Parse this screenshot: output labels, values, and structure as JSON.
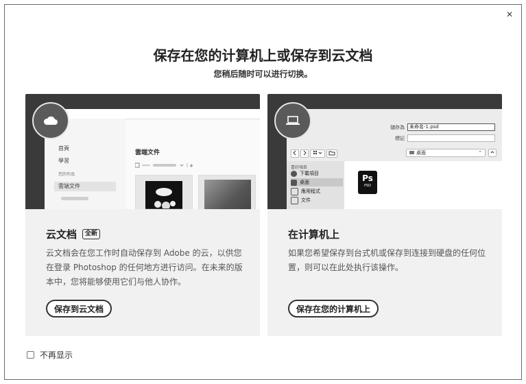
{
  "dialog": {
    "close_symbol": "×",
    "title": "保存在您的计算机上或保存到云文档",
    "subtitle": "您稍后随时可以进行切换。"
  },
  "cloud_card": {
    "badge_icon": "cloud-icon",
    "preview": {
      "nav_items": [
        "首頁",
        "學習",
        "您的作品",
        "雲端文件"
      ],
      "active_nav": "雲端文件",
      "main_title": "雲端文件"
    },
    "heading": "云文档",
    "tag": "全新",
    "description": "云文档会在您工作时自动保存到 Adobe 的云，以供您在登录 Photoshop 的任何地方进行访问。在未来的版本中，您将能够使用它们与他人协作。",
    "button_label": "保存到云文档"
  },
  "computer_card": {
    "badge_icon": "laptop-icon",
    "preview": {
      "save_as_label": "儲存為",
      "save_as_value": "未命名-1.psd",
      "tags_label": "標記",
      "location": "桌面",
      "sidebar_header": "喜好項目",
      "sidebar_items": [
        "下載項目",
        "桌面",
        "應用程式",
        "文件"
      ],
      "selected_item": "桌面",
      "file_icon_text": "Ps",
      "file_icon_sub": "PSD"
    },
    "heading": "在计算机上",
    "description": "如果您希望保存到台式机或保存到连接到硬盘的任何位置，则可以在此处执行该操作。",
    "button_label": "保存在您的计算机上"
  },
  "footer": {
    "dont_show_label": "不再显示",
    "dont_show_checked": false
  },
  "colors": {
    "preview_bg": "#3a3a3a",
    "card_bg": "#f1f1f1",
    "border": "#333333"
  }
}
